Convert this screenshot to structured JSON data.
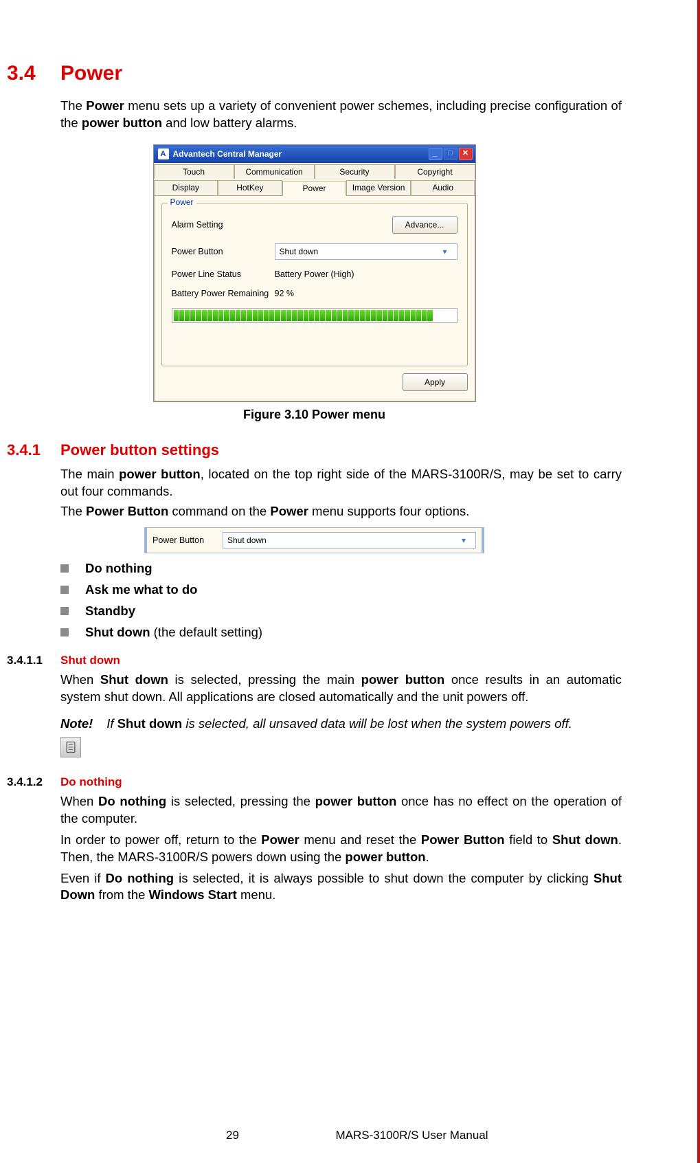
{
  "section": {
    "num": "3.4",
    "title": "Power",
    "intro_parts": {
      "p1": "The ",
      "b1": "Power",
      "p2": " menu sets up a variety of convenient power schemes, including precise configuration of the ",
      "b2": "power button",
      "p3": " and low battery alarms."
    }
  },
  "dialog": {
    "title": "Advantech Central Manager",
    "logo": "A",
    "tabs": [
      "Touch",
      "Communication",
      "Security",
      "Copyright",
      "Display",
      "HotKey",
      "Power",
      "Image Version",
      "Audio"
    ],
    "active_tab_index": 6,
    "group_legend": "Power",
    "rows": {
      "alarm_label": "Alarm Setting",
      "advance_btn": "Advance...",
      "power_button_label": "Power Button",
      "power_button_value": "Shut down",
      "power_line_label": "Power Line Status",
      "power_line_value": "Battery Power (High)",
      "batt_remain_label": "Battery Power Remaining",
      "batt_remain_value": "92 %"
    },
    "progress_segments": 50,
    "progress_filled": 46,
    "apply_btn": "Apply"
  },
  "figure_caption": "Figure 3.10 Power menu",
  "subsection": {
    "num": "3.4.1",
    "title": "Power button settings",
    "p1": {
      "a": "The main ",
      "b1": "power button",
      "c": ", located on the top right side of the MARS-3100R/S, may be set to carry out four commands."
    },
    "p2": {
      "a": "The ",
      "b1": "Power Button",
      "b": " command on the ",
      "b2": "Power",
      "c": " menu supports four options."
    }
  },
  "mini_field": {
    "label": "Power Button",
    "value": "Shut down"
  },
  "bullets": {
    "b1": "Do nothing",
    "b2": "Ask me what to do",
    "b3": "Standby",
    "b4_bold": "Shut down",
    "b4_rest": " (the default setting)"
  },
  "sub1": {
    "num": "3.4.1.1",
    "title": "Shut down",
    "body": {
      "p1a": "When ",
      "b1": "Shut down",
      "p1b": " is selected, pressing the main ",
      "b2": "power button",
      "p1c": " once results in an automatic system shut down. All applications are closed automatically and the unit powers off."
    },
    "note": {
      "label": "Note!",
      "t1": "If ",
      "b1": "Shut down",
      "t2": " is selected, all unsaved data will be lost when the system powers off."
    }
  },
  "sub2": {
    "num": "3.4.1.2",
    "title": "Do nothing",
    "p1": {
      "a": "When ",
      "b1": "Do nothing",
      "b": " is selected, pressing the ",
      "b2": "power button",
      "c": " once has no effect on the operation of the computer."
    },
    "p2": {
      "a": "In order to power off, return to the ",
      "b1": "Power",
      "b": " menu and reset the ",
      "b2": "Power Button",
      "c": " field to ",
      "b3": "Shut down",
      "d": ". Then, the MARS-3100R/S powers down using the ",
      "b4": "power button",
      "e": "."
    },
    "p3": {
      "a": "Even if ",
      "b1": "Do nothing",
      "b": " is selected, it is always possible to shut down the computer by clicking ",
      "b2": "Shut Down",
      "c": " from the ",
      "b3": "Windows Start",
      "d": " menu."
    }
  },
  "footer": {
    "page": "29",
    "doc": "MARS-3100R/S User Manual"
  }
}
